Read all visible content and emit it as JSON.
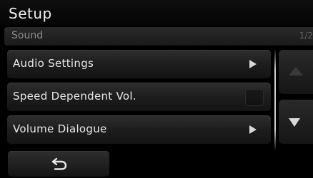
{
  "header": {
    "title": "Setup"
  },
  "section": {
    "label": "Sound",
    "page_indicator": "1/2"
  },
  "menu": {
    "items": [
      {
        "label": "Audio Settings",
        "control": "arrow-right"
      },
      {
        "label": "Speed Dependent Vol.",
        "control": "checkbox",
        "checked": false
      },
      {
        "label": "Volume Dialogue",
        "control": "arrow-right"
      }
    ]
  },
  "scroll": {
    "up_icon": "triangle-up-icon",
    "down_icon": "triangle-down-icon",
    "up_enabled": false,
    "down_enabled": true
  },
  "footer": {
    "back_icon": "return-arrow-icon"
  },
  "colors": {
    "background": "#000000",
    "text": "#e8e8e8",
    "muted": "#8c8c8c"
  }
}
